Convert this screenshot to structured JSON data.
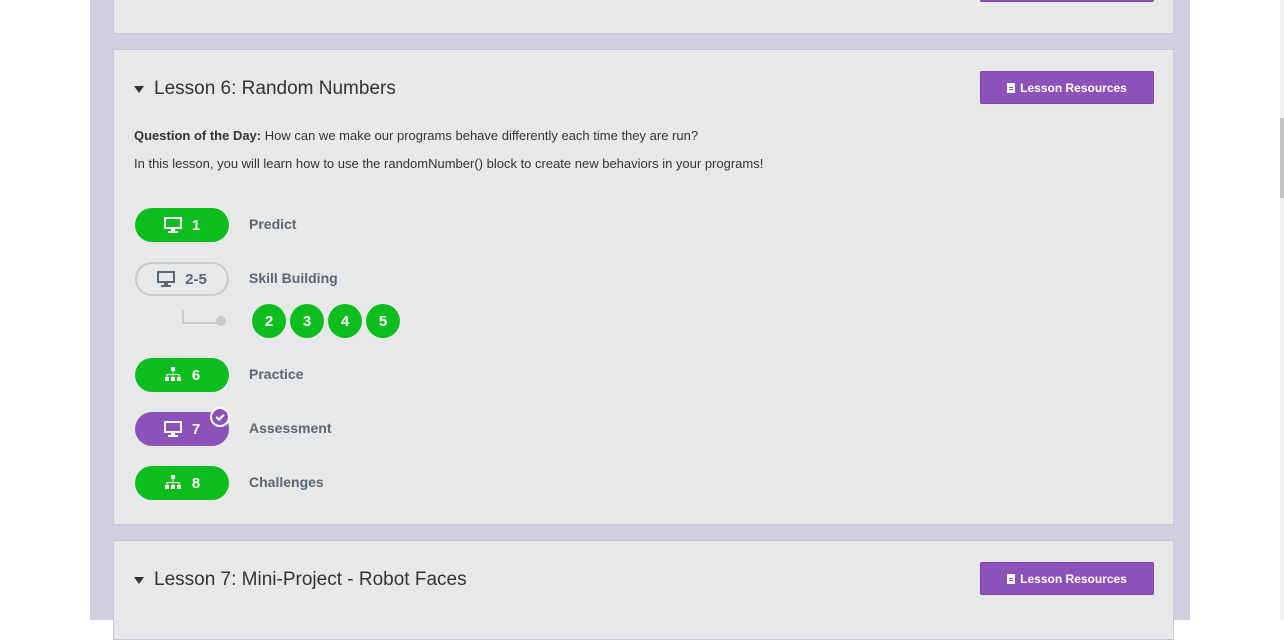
{
  "resources_label": "Lesson Resources",
  "lesson6": {
    "title": "Lesson 6: Random Numbers",
    "qotd_label": "Question of the Day:",
    "qotd_text": " How can we make our programs behave differently each time they are run?",
    "description": "In this lesson, you will learn how to use the randomNumber() block to create new behaviors in your programs!",
    "steps": [
      {
        "num": "1",
        "label": "Predict",
        "icon": "monitor-icon",
        "status": "completed"
      },
      {
        "num": "2-5",
        "label": "Skill Building",
        "icon": "monitor-icon",
        "status": "not-started"
      },
      {
        "num": "6",
        "label": "Practice",
        "icon": "hierarchy-icon",
        "status": "completed"
      },
      {
        "num": "7",
        "label": "Assessment",
        "icon": "monitor-icon",
        "status": "submitted"
      },
      {
        "num": "8",
        "label": "Challenges",
        "icon": "hierarchy-icon",
        "status": "completed"
      }
    ],
    "sublevels": [
      "2",
      "3",
      "4",
      "5"
    ]
  },
  "lesson7": {
    "title": "Lesson 7: Mini-Project - Robot Faces"
  },
  "colors": {
    "green": "#0dbd1e",
    "purple": "#8c52ba",
    "grey_text": "#5b6770"
  }
}
